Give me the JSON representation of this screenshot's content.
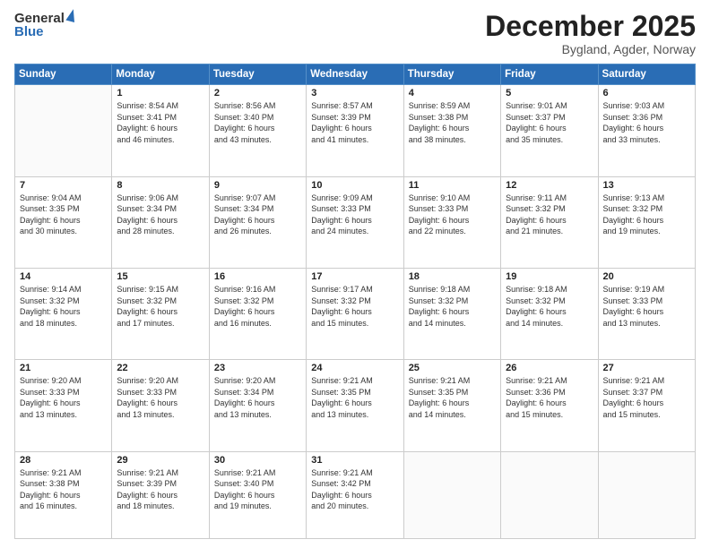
{
  "logo": {
    "line1": "General",
    "line2": "Blue"
  },
  "title": {
    "month_year": "December 2025",
    "location": "Bygland, Agder, Norway"
  },
  "days_of_week": [
    "Sunday",
    "Monday",
    "Tuesday",
    "Wednesday",
    "Thursday",
    "Friday",
    "Saturday"
  ],
  "weeks": [
    [
      {
        "day": "",
        "info": ""
      },
      {
        "day": "1",
        "info": "Sunrise: 8:54 AM\nSunset: 3:41 PM\nDaylight: 6 hours\nand 46 minutes."
      },
      {
        "day": "2",
        "info": "Sunrise: 8:56 AM\nSunset: 3:40 PM\nDaylight: 6 hours\nand 43 minutes."
      },
      {
        "day": "3",
        "info": "Sunrise: 8:57 AM\nSunset: 3:39 PM\nDaylight: 6 hours\nand 41 minutes."
      },
      {
        "day": "4",
        "info": "Sunrise: 8:59 AM\nSunset: 3:38 PM\nDaylight: 6 hours\nand 38 minutes."
      },
      {
        "day": "5",
        "info": "Sunrise: 9:01 AM\nSunset: 3:37 PM\nDaylight: 6 hours\nand 35 minutes."
      },
      {
        "day": "6",
        "info": "Sunrise: 9:03 AM\nSunset: 3:36 PM\nDaylight: 6 hours\nand 33 minutes."
      }
    ],
    [
      {
        "day": "7",
        "info": "Sunrise: 9:04 AM\nSunset: 3:35 PM\nDaylight: 6 hours\nand 30 minutes."
      },
      {
        "day": "8",
        "info": "Sunrise: 9:06 AM\nSunset: 3:34 PM\nDaylight: 6 hours\nand 28 minutes."
      },
      {
        "day": "9",
        "info": "Sunrise: 9:07 AM\nSunset: 3:34 PM\nDaylight: 6 hours\nand 26 minutes."
      },
      {
        "day": "10",
        "info": "Sunrise: 9:09 AM\nSunset: 3:33 PM\nDaylight: 6 hours\nand 24 minutes."
      },
      {
        "day": "11",
        "info": "Sunrise: 9:10 AM\nSunset: 3:33 PM\nDaylight: 6 hours\nand 22 minutes."
      },
      {
        "day": "12",
        "info": "Sunrise: 9:11 AM\nSunset: 3:32 PM\nDaylight: 6 hours\nand 21 minutes."
      },
      {
        "day": "13",
        "info": "Sunrise: 9:13 AM\nSunset: 3:32 PM\nDaylight: 6 hours\nand 19 minutes."
      }
    ],
    [
      {
        "day": "14",
        "info": "Sunrise: 9:14 AM\nSunset: 3:32 PM\nDaylight: 6 hours\nand 18 minutes."
      },
      {
        "day": "15",
        "info": "Sunrise: 9:15 AM\nSunset: 3:32 PM\nDaylight: 6 hours\nand 17 minutes."
      },
      {
        "day": "16",
        "info": "Sunrise: 9:16 AM\nSunset: 3:32 PM\nDaylight: 6 hours\nand 16 minutes."
      },
      {
        "day": "17",
        "info": "Sunrise: 9:17 AM\nSunset: 3:32 PM\nDaylight: 6 hours\nand 15 minutes."
      },
      {
        "day": "18",
        "info": "Sunrise: 9:18 AM\nSunset: 3:32 PM\nDaylight: 6 hours\nand 14 minutes."
      },
      {
        "day": "19",
        "info": "Sunrise: 9:18 AM\nSunset: 3:32 PM\nDaylight: 6 hours\nand 14 minutes."
      },
      {
        "day": "20",
        "info": "Sunrise: 9:19 AM\nSunset: 3:33 PM\nDaylight: 6 hours\nand 13 minutes."
      }
    ],
    [
      {
        "day": "21",
        "info": "Sunrise: 9:20 AM\nSunset: 3:33 PM\nDaylight: 6 hours\nand 13 minutes."
      },
      {
        "day": "22",
        "info": "Sunrise: 9:20 AM\nSunset: 3:33 PM\nDaylight: 6 hours\nand 13 minutes."
      },
      {
        "day": "23",
        "info": "Sunrise: 9:20 AM\nSunset: 3:34 PM\nDaylight: 6 hours\nand 13 minutes."
      },
      {
        "day": "24",
        "info": "Sunrise: 9:21 AM\nSunset: 3:35 PM\nDaylight: 6 hours\nand 13 minutes."
      },
      {
        "day": "25",
        "info": "Sunrise: 9:21 AM\nSunset: 3:35 PM\nDaylight: 6 hours\nand 14 minutes."
      },
      {
        "day": "26",
        "info": "Sunrise: 9:21 AM\nSunset: 3:36 PM\nDaylight: 6 hours\nand 15 minutes."
      },
      {
        "day": "27",
        "info": "Sunrise: 9:21 AM\nSunset: 3:37 PM\nDaylight: 6 hours\nand 15 minutes."
      }
    ],
    [
      {
        "day": "28",
        "info": "Sunrise: 9:21 AM\nSunset: 3:38 PM\nDaylight: 6 hours\nand 16 minutes."
      },
      {
        "day": "29",
        "info": "Sunrise: 9:21 AM\nSunset: 3:39 PM\nDaylight: 6 hours\nand 18 minutes."
      },
      {
        "day": "30",
        "info": "Sunrise: 9:21 AM\nSunset: 3:40 PM\nDaylight: 6 hours\nand 19 minutes."
      },
      {
        "day": "31",
        "info": "Sunrise: 9:21 AM\nSunset: 3:42 PM\nDaylight: 6 hours\nand 20 minutes."
      },
      {
        "day": "",
        "info": ""
      },
      {
        "day": "",
        "info": ""
      },
      {
        "day": "",
        "info": ""
      }
    ]
  ]
}
